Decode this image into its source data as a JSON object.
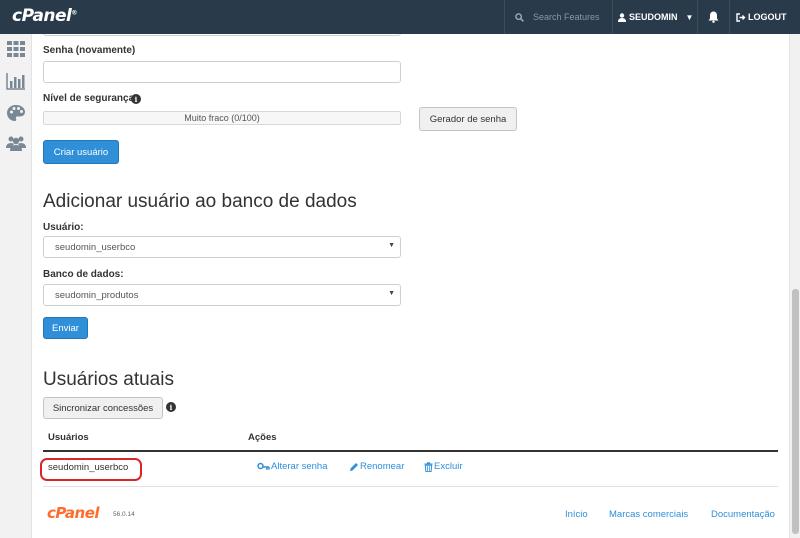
{
  "header": {
    "logo_text": "cPanel",
    "logo_mark": "®",
    "search_placeholder": "Search Features",
    "username": "SEUDOMIN",
    "logout_label": "LOGOUT"
  },
  "sidebar": {
    "icons": [
      "grid-icon",
      "stats-icon",
      "palette-icon",
      "users-icon"
    ]
  },
  "form": {
    "password_again_label": "Senha (novamente)",
    "security_level_label": "Nível de segurança",
    "strength_text": "Muito fraco (0/100)",
    "generator_button": "Gerador de senha",
    "create_button": "Criar usuário"
  },
  "add_user_section": {
    "title": "Adicionar usuário ao banco de dados",
    "user_label": "Usuário:",
    "user_value": "seudomin_userbco",
    "database_label": "Banco de dados:",
    "database_value": "seudomin_produtos",
    "submit_button": "Enviar"
  },
  "current_users": {
    "title": "Usuários atuais",
    "sync_button": "Sincronizar concessões",
    "columns": [
      "Usuários",
      "Ações"
    ],
    "rows": [
      {
        "user": "seudomin_userbco",
        "actions": [
          "Alterar senha",
          "Renomear",
          "Excluir"
        ]
      }
    ]
  },
  "footer": {
    "logo_text": "cPanel",
    "version": "56.0.14",
    "links": [
      "Início",
      "Marcas comerciais",
      "Documentação"
    ]
  },
  "colors": {
    "topbar": "#293a4a",
    "primary": "#2f8fd8",
    "highlight": "#d9262a",
    "footer_logo": "#ff6c2c"
  }
}
